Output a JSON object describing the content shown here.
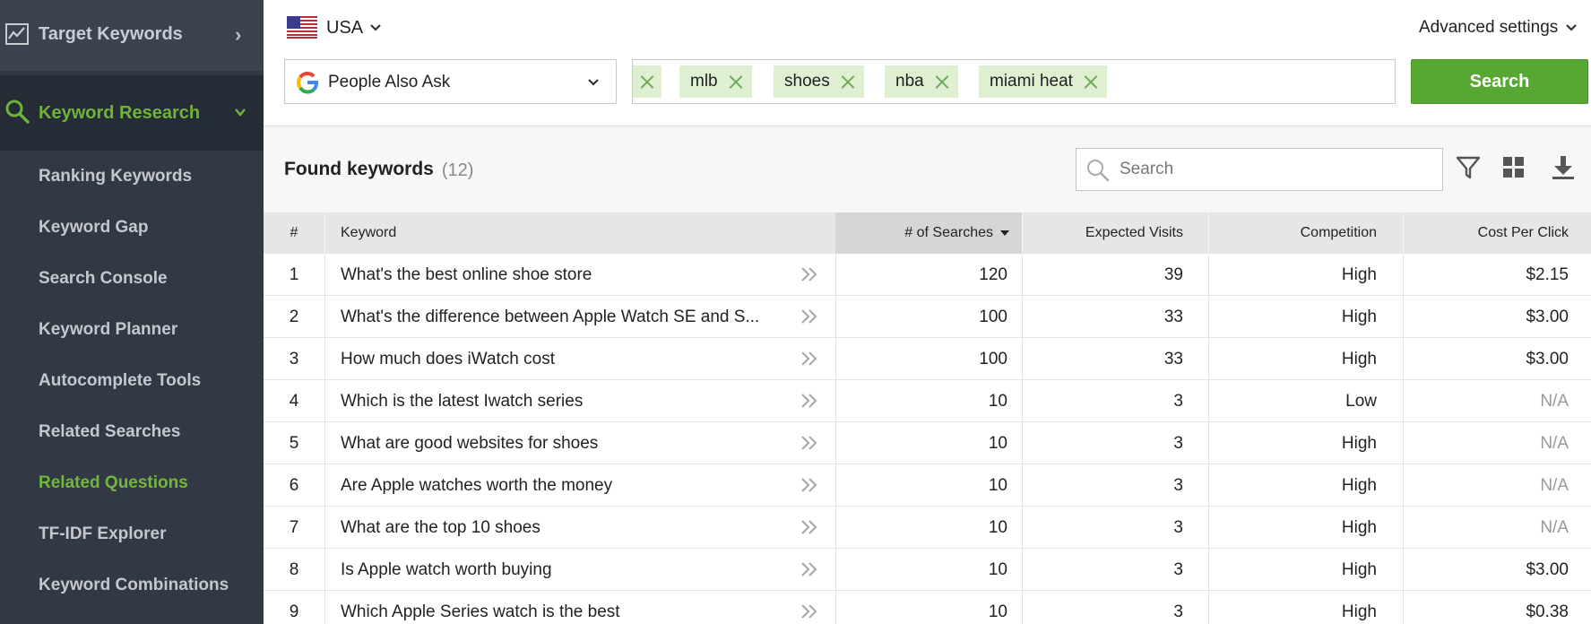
{
  "sidebar": {
    "target_keywords": "Target Keywords",
    "keyword_research": "Keyword Research",
    "items": [
      {
        "label": "Ranking Keywords",
        "active": false
      },
      {
        "label": "Keyword Gap",
        "active": false
      },
      {
        "label": "Search Console",
        "active": false
      },
      {
        "label": "Keyword Planner",
        "active": false
      },
      {
        "label": "Autocomplete Tools",
        "active": false
      },
      {
        "label": "Related Searches",
        "active": false
      },
      {
        "label": "Related Questions",
        "active": true
      },
      {
        "label": "TF-IDF Explorer",
        "active": false
      },
      {
        "label": "Keyword Combinations",
        "active": false
      }
    ]
  },
  "topbar": {
    "country": "USA",
    "advanced_settings": "Advanced settings"
  },
  "source": {
    "label": "People Also Ask"
  },
  "tags": [
    "mlb",
    "shoes",
    "nba",
    "miami heat"
  ],
  "search_button": "Search",
  "results": {
    "title": "Found keywords",
    "count": "(12)",
    "search_placeholder": "Search"
  },
  "table": {
    "headers": {
      "num": "#",
      "keyword": "Keyword",
      "searches": "# of Searches",
      "visits": "Expected Visits",
      "competition": "Competition",
      "cpc": "Cost Per Click"
    },
    "rows": [
      {
        "num": "1",
        "keyword": "What's the best online shoe store",
        "searches": "120",
        "visits": "39",
        "competition": "High",
        "cpc": "$2.15"
      },
      {
        "num": "2",
        "keyword": "What's the difference between Apple Watch SE and S...",
        "searches": "100",
        "visits": "33",
        "competition": "High",
        "cpc": "$3.00"
      },
      {
        "num": "3",
        "keyword": "How much does iWatch cost",
        "searches": "100",
        "visits": "33",
        "competition": "High",
        "cpc": "$3.00"
      },
      {
        "num": "4",
        "keyword": "Which is the latest Iwatch series",
        "searches": "10",
        "visits": "3",
        "competition": "Low",
        "cpc": "N/A"
      },
      {
        "num": "5",
        "keyword": "What are good websites for shoes",
        "searches": "10",
        "visits": "3",
        "competition": "High",
        "cpc": "N/A"
      },
      {
        "num": "6",
        "keyword": "Are Apple watches worth the money",
        "searches": "10",
        "visits": "3",
        "competition": "High",
        "cpc": "N/A"
      },
      {
        "num": "7",
        "keyword": "What are the top 10 shoes",
        "searches": "10",
        "visits": "3",
        "competition": "High",
        "cpc": "N/A"
      },
      {
        "num": "8",
        "keyword": "Is Apple watch worth buying",
        "searches": "10",
        "visits": "3",
        "competition": "High",
        "cpc": "$3.00"
      },
      {
        "num": "9",
        "keyword": "Which Apple Series watch is the best",
        "searches": "10",
        "visits": "3",
        "competition": "High",
        "cpc": "$0.38"
      }
    ]
  },
  "colors": {
    "sidebar_bg": "#323944",
    "accent_green": "#57a833",
    "active_green": "#72b73c",
    "tag_bg": "#dff0d2"
  },
  "icons": [
    "chart-icon",
    "chevron-right-icon",
    "search-icon",
    "chevron-down-icon",
    "us-flag-icon",
    "google-icon",
    "close-icon",
    "filter-icon",
    "grid-icon",
    "download-icon",
    "double-chevron-icon"
  ]
}
